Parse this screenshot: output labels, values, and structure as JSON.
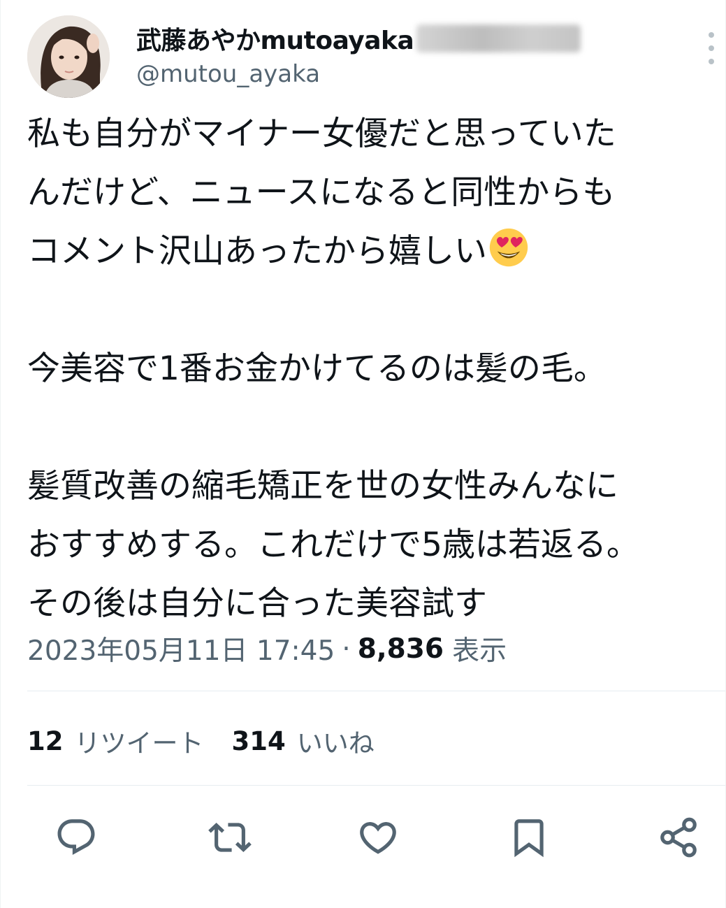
{
  "header": {
    "display_name": "武藤あやかmutoayaka",
    "handle": "@mutou_ayaka"
  },
  "tweet": {
    "lines": [
      "私も自分がマイナー女優だと思っていた",
      "んだけど、ニュースになると同性からも",
      "コメント沢山あったから嬉しい",
      "",
      "今美容で1番お金かけてるのは髪の毛。",
      "",
      "髪質改善の縮毛矯正を世の女性みんなに",
      "おすすめする。これだけで5歳は若返る。",
      "その後は自分に合った美容試す"
    ],
    "emoji": "smiling-face-with-heart-eyes"
  },
  "meta": {
    "timestamp": "2023年05月11日 17:45",
    "separator": "·",
    "views_count": "8,836",
    "views_label": "表示"
  },
  "stats": {
    "retweets_count": "12",
    "retweets_label": "リツイート",
    "likes_count": "314",
    "likes_label": "いいね"
  },
  "actions": [
    {
      "icon": "reply-icon"
    },
    {
      "icon": "retweet-icon"
    },
    {
      "icon": "like-icon"
    },
    {
      "icon": "bookmark-icon"
    },
    {
      "icon": "share-icon"
    }
  ],
  "colors": {
    "text": "#0f1419",
    "secondary": "#536471",
    "divider": "#e6ecf0",
    "icon": "#536471"
  }
}
